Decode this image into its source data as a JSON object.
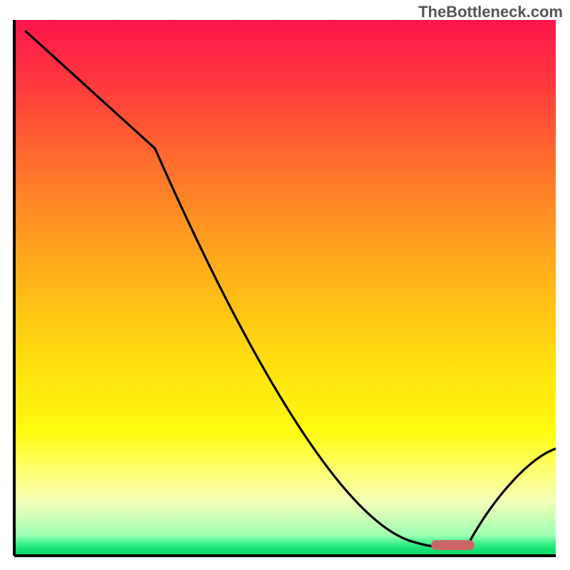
{
  "watermark": "TheBottleneck.com",
  "chart_data": {
    "type": "line",
    "title": "",
    "xlabel": "",
    "ylabel": "",
    "xlim": [
      0,
      100
    ],
    "ylim": [
      0,
      100
    ],
    "x": [
      2,
      26,
      74,
      80.5,
      84,
      100
    ],
    "values": [
      98,
      76,
      2.5,
      1.5,
      2.5,
      20
    ],
    "optimal_marker": {
      "x_start": 77,
      "x_end": 85,
      "y": 2
    },
    "gradient_stops": [
      {
        "offset": 0.0,
        "color": "#ff154b"
      },
      {
        "offset": 0.128,
        "color": "#ff3c3c"
      },
      {
        "offset": 0.256,
        "color": "#ff6b2f"
      },
      {
        "offset": 0.385,
        "color": "#ff9621"
      },
      {
        "offset": 0.513,
        "color": "#ffbc17"
      },
      {
        "offset": 0.641,
        "color": "#ffdf10"
      },
      {
        "offset": 0.769,
        "color": "#fff90f"
      },
      {
        "offset": 0.833,
        "color": "#fdff65"
      },
      {
        "offset": 0.897,
        "color": "#f6ffb6"
      },
      {
        "offset": 0.962,
        "color": "#9effb4"
      },
      {
        "offset": 0.974,
        "color": "#4cf590"
      },
      {
        "offset": 0.987,
        "color": "#17e274"
      },
      {
        "offset": 1.0,
        "color": "#07d666"
      }
    ],
    "axis_color": "#000000",
    "line_color": "#000000",
    "marker_color": "#cc6666"
  }
}
